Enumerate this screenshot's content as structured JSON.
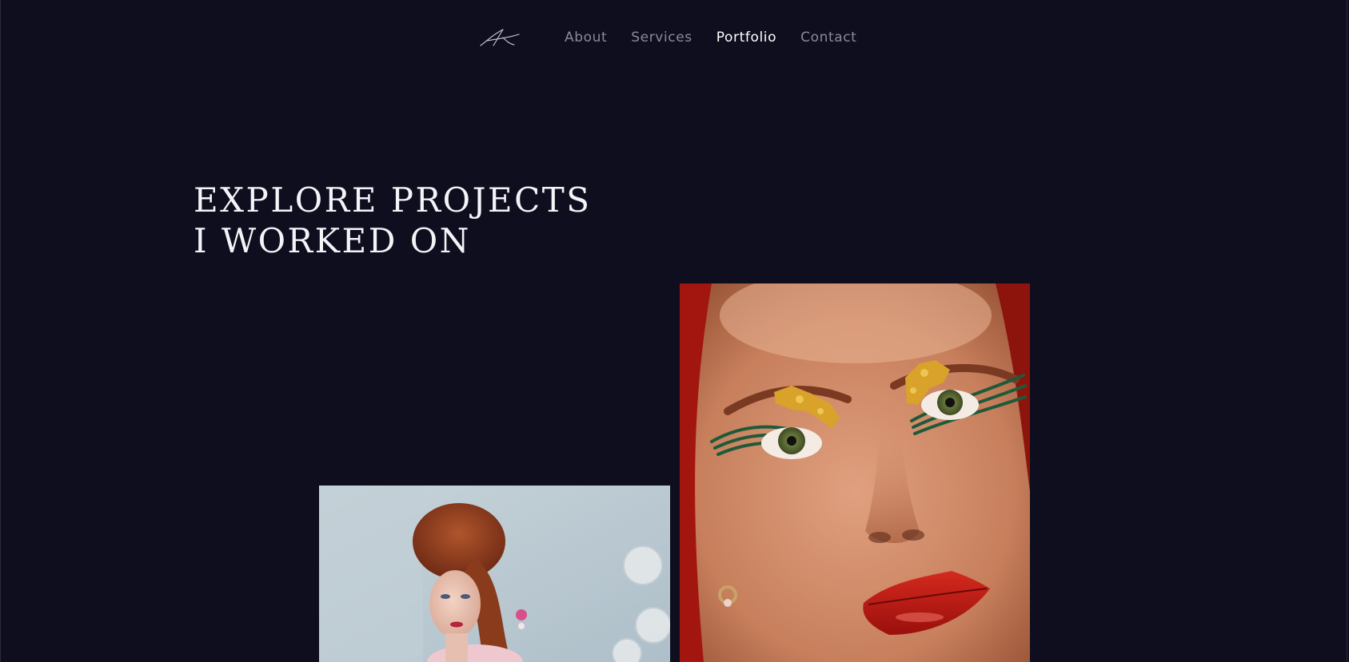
{
  "logo": {
    "icon": "signature-logo-icon",
    "alt": "AK signature logo"
  },
  "nav": {
    "items": [
      {
        "label": "About",
        "active": false
      },
      {
        "label": "Services",
        "active": false
      },
      {
        "label": "Portfolio",
        "active": true
      },
      {
        "label": "Contact",
        "active": false
      }
    ]
  },
  "hero": {
    "line1": "EXPLORE PROJECTS",
    "line2": "I WORKED ON"
  },
  "projects": [
    {
      "image": "period-portrait-redhead-image"
    },
    {
      "image": "gold-leaf-eye-makeup-image"
    }
  ],
  "colors": {
    "background": "#0e0e1f",
    "nav_text": "#8a8a9a",
    "nav_active": "#ffffff",
    "heading": "#f4f4f8"
  }
}
